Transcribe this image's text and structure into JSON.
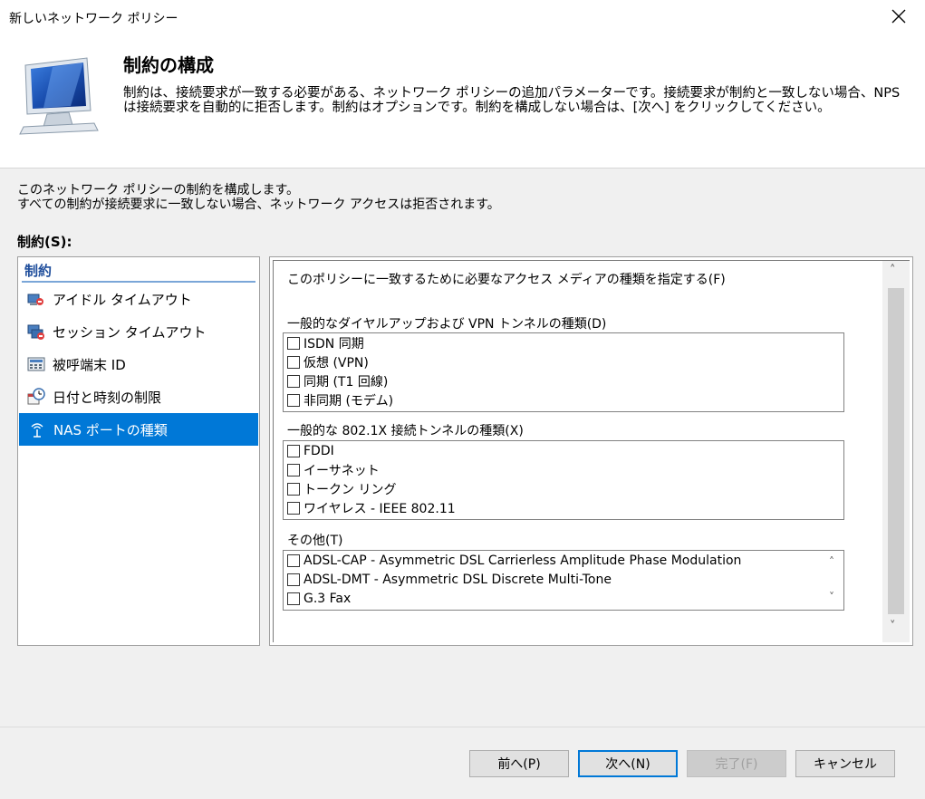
{
  "window": {
    "title": "新しいネットワーク ポリシー"
  },
  "header": {
    "title": "制約の構成",
    "description": "制約は、接続要求が一致する必要がある、ネットワーク ポリシーの追加パラメーターです。接続要求が制約と一致しない場合、NPS は接続要求を自動的に拒否します。制約はオプションです。制約を構成しない場合は、[次へ] をクリックしてください。"
  },
  "intro": {
    "line1": "このネットワーク ポリシーの制約を構成します。",
    "line2": "すべての制約が接続要求に一致しない場合、ネットワーク アクセスは拒否されます。"
  },
  "constraints_label": "制約(S):",
  "left_panel": {
    "header": "制約",
    "items": [
      {
        "label": "アイドル タイムアウト",
        "icon": "idle-timeout-icon"
      },
      {
        "label": "セッション タイムアウト",
        "icon": "session-timeout-icon"
      },
      {
        "label": "被呼端末 ID",
        "icon": "called-station-icon"
      },
      {
        "label": "日付と時刻の制限",
        "icon": "day-time-icon"
      },
      {
        "label": "NAS ポートの種類",
        "icon": "nas-port-icon",
        "selected": true
      }
    ]
  },
  "right_panel": {
    "instruction": "このポリシーに一致するために必要なアクセス メディアの種類を指定する(F)",
    "dialup": {
      "label": "一般的なダイヤルアップおよび VPN トンネルの種類(D)",
      "items": [
        "ISDN 同期",
        "仮想 (VPN)",
        "同期 (T1 回線)",
        "非同期 (モデム)"
      ]
    },
    "dot1x": {
      "label": "一般的な 802.1X 接続トンネルの種類(X)",
      "items": [
        "FDDI",
        "イーサネット",
        "トークン リング",
        "ワイヤレス - IEEE 802.11"
      ]
    },
    "other": {
      "label": "その他(T)",
      "items": [
        "ADSL-CAP - Asymmetric DSL Carrierless Amplitude Phase Modulation",
        "ADSL-DMT - Asymmetric DSL Discrete Multi-Tone",
        "G.3 Fax"
      ]
    }
  },
  "footer": {
    "prev": "前へ(P)",
    "next": "次へ(N)",
    "finish": "完了(F)",
    "cancel": "キャンセル"
  },
  "colors": {
    "accent": "#0078d7",
    "selected_bg": "#0078d7"
  }
}
